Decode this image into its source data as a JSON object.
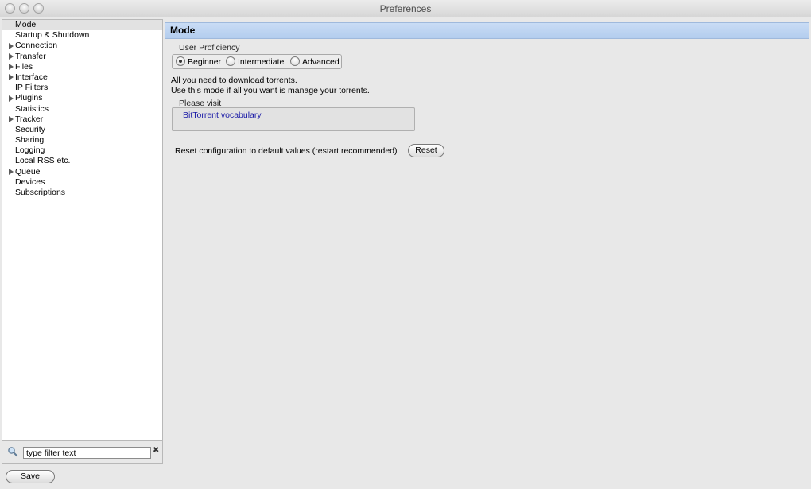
{
  "window": {
    "title": "Preferences"
  },
  "sidebar": {
    "items": [
      {
        "label": "Mode",
        "expandable": false,
        "selected": true
      },
      {
        "label": "Startup & Shutdown",
        "expandable": false
      },
      {
        "label": "Connection",
        "expandable": true
      },
      {
        "label": "Transfer",
        "expandable": true
      },
      {
        "label": "Files",
        "expandable": true
      },
      {
        "label": "Interface",
        "expandable": true
      },
      {
        "label": "IP Filters",
        "expandable": false
      },
      {
        "label": "Plugins",
        "expandable": true
      },
      {
        "label": "Statistics",
        "expandable": false
      },
      {
        "label": "Tracker",
        "expandable": true
      },
      {
        "label": "Security",
        "expandable": false
      },
      {
        "label": "Sharing",
        "expandable": false
      },
      {
        "label": "Logging",
        "expandable": false
      },
      {
        "label": "Local RSS etc.",
        "expandable": false
      },
      {
        "label": "Queue",
        "expandable": true
      },
      {
        "label": "Devices",
        "expandable": false
      },
      {
        "label": "Subscriptions",
        "expandable": false
      }
    ],
    "filter": {
      "value": "type filter text"
    }
  },
  "footer": {
    "save_label": "Save"
  },
  "main": {
    "section_title": "Mode",
    "proficiency": {
      "label": "User Proficiency",
      "options": [
        "Beginner",
        "Intermediate",
        "Advanced"
      ],
      "selected": "Beginner"
    },
    "description_line1": "All you need to download torrents.",
    "description_line2": "Use this mode if all you want is manage your torrents.",
    "visit": {
      "label": "Please visit",
      "link_text": "BitTorrent vocabulary"
    },
    "reset": {
      "label": "Reset configuration to default values (restart recommended)",
      "button_label": "Reset"
    }
  },
  "colors": {
    "header_bg": "#b3cdee",
    "link": "#1a1aa6",
    "selected_row": "#e2e2e2"
  }
}
